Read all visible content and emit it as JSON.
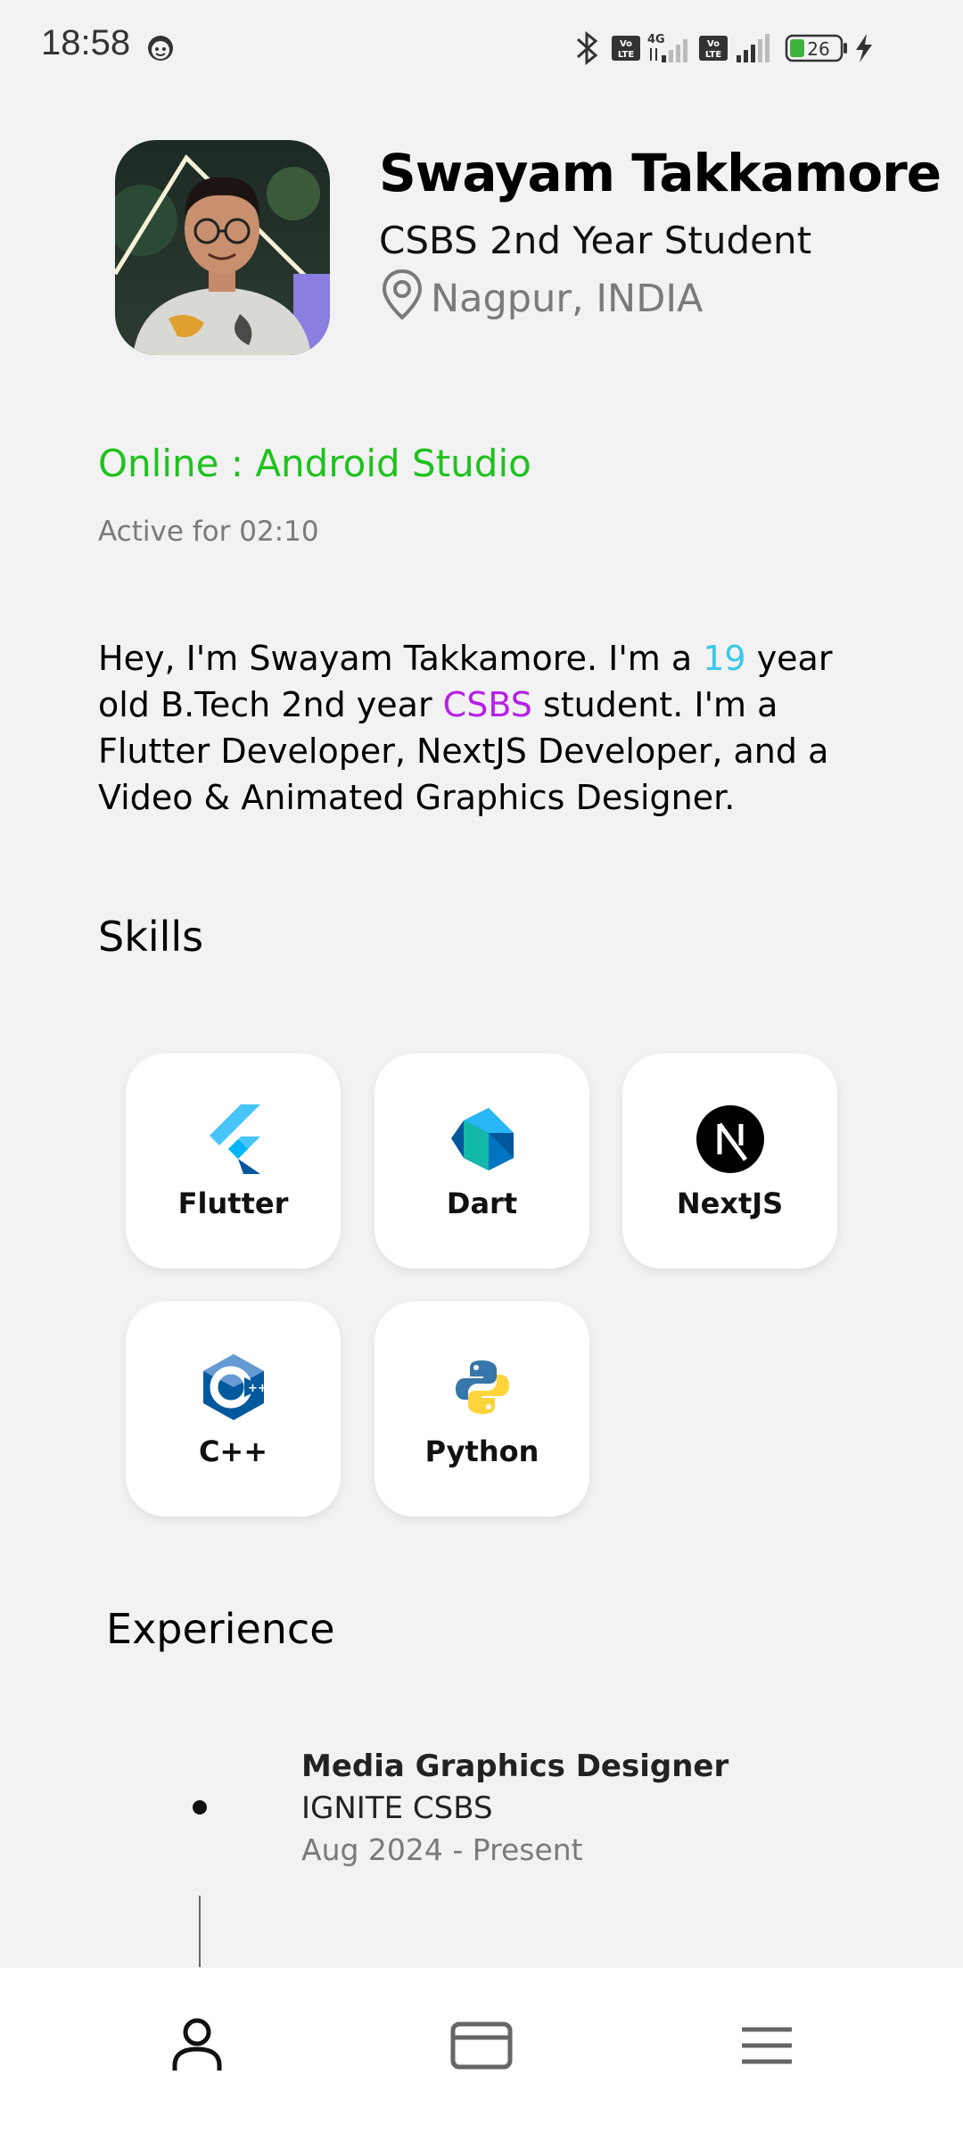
{
  "status_bar": {
    "time": "18:58",
    "battery": "26",
    "icons": [
      "face-icon",
      "bluetooth-icon",
      "volte-icon",
      "4g-icon",
      "signal-icon",
      "battery-icon",
      "charging-icon"
    ]
  },
  "profile": {
    "name": "Swayam Takkamore",
    "role": "CSBS 2nd Year Student",
    "location": "Nagpur, INDIA",
    "online_status": "Online : Android Studio",
    "active_for": "Active for 02:10"
  },
  "bio": {
    "part1": "Hey, I'm Swayam Takkamore. I'm a ",
    "age": "19",
    "part2": " year old B.Tech 2nd year ",
    "dept": "CSBS",
    "part3": " student. I'm a Flutter Developer, NextJS Developer, and a Video & Animated Graphics Designer."
  },
  "skills": {
    "title": "Skills",
    "items": [
      {
        "label": "Flutter",
        "icon": "flutter-icon"
      },
      {
        "label": "Dart",
        "icon": "dart-icon"
      },
      {
        "label": "NextJS",
        "icon": "nextjs-icon"
      },
      {
        "label": "C++",
        "icon": "cpp-icon"
      },
      {
        "label": "Python",
        "icon": "python-icon"
      }
    ]
  },
  "experience": {
    "title": "Experience",
    "items": [
      {
        "title": "Media Graphics Designer",
        "org": "IGNITE CSBS",
        "dates": "Aug 2024 - Present"
      }
    ]
  },
  "bottom_nav": {
    "items": [
      "profile-icon",
      "card-icon",
      "menu-icon"
    ]
  },
  "colors": {
    "online": "#1fc21f",
    "age_highlight": "#3bc7e8",
    "dept_highlight": "#b620e6",
    "background": "#f2f2f2"
  }
}
